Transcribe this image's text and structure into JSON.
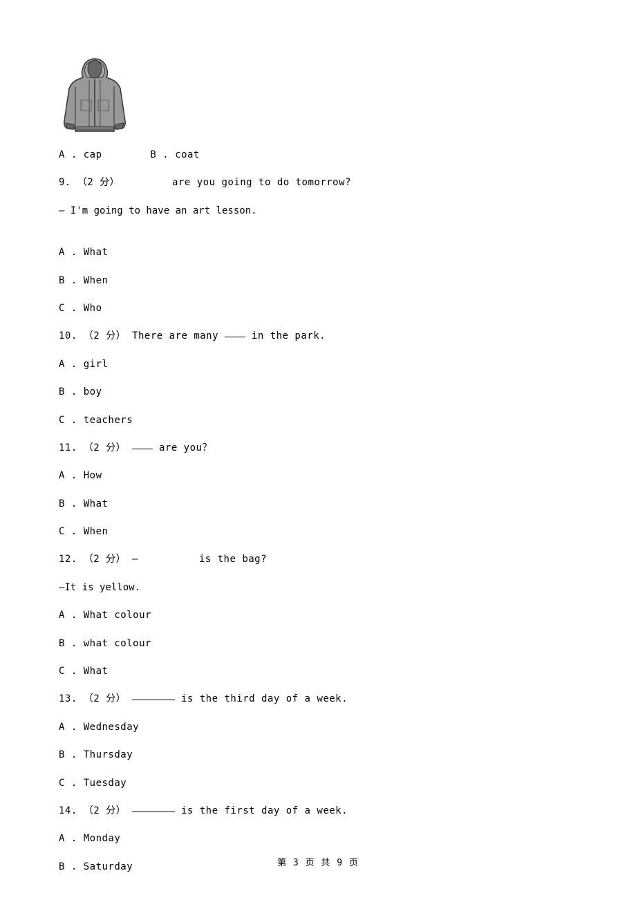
{
  "inline_options_8": {
    "a_label": "A",
    "a_text": "cap",
    "b_label": "B",
    "b_text": "coat"
  },
  "q9": {
    "prefix": "9.",
    "points": "（2 分）",
    "text_after": "are you going to do tomorrow?",
    "dialog": "— I'm going to have an art lesson.",
    "a": "A . What",
    "b": "B . When",
    "c": "C . Who"
  },
  "q10": {
    "prefix": "10.",
    "points": "（2 分）",
    "text_before": " There are many ",
    "text_after": " in the park.",
    "a": "A . girl",
    "b": "B . boy",
    "c": "C . teachers"
  },
  "q11": {
    "prefix": "11.",
    "points": "（2 分）",
    "text_after": "are you？",
    "a": "A . How",
    "b": "B . What",
    "c": "C . When"
  },
  "q12": {
    "prefix": "12.",
    "points": "（2 分）",
    "dash": " — ",
    "text_after": "is the bag?",
    "dialog": "—It is yellow.",
    "a": "A . What colour",
    "b": "B . what colour",
    "c": "C . What"
  },
  "q13": {
    "prefix": "13.",
    "points": "（2 分）",
    "text_after": " is the third day of a week.",
    "a": "A . Wednesday",
    "b": "B . Thursday",
    "c": "C . Tuesday"
  },
  "q14": {
    "prefix": "14.",
    "points": "（2 分）",
    "text_after": " is the first day of a week.",
    "a": "A . Monday",
    "b": "B . Saturday"
  },
  "footer": "第 3 页 共 9 页"
}
